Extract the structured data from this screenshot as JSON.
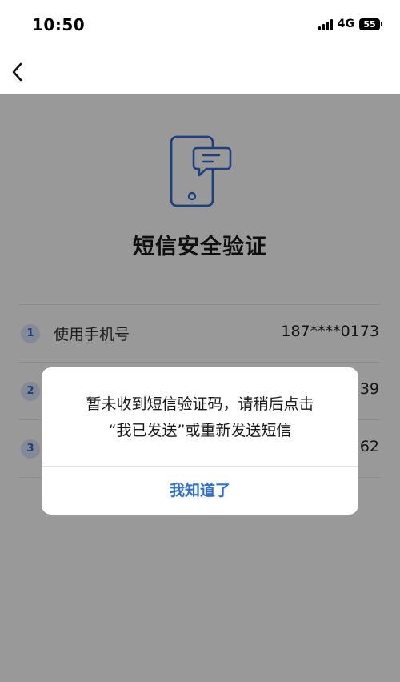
{
  "status_bar": {
    "time": "10:50",
    "network": "4G",
    "battery": "55"
  },
  "nav": {
    "back_icon": "chevron-left-icon"
  },
  "page": {
    "hero_icon": "phone-message-icon",
    "title": "短信安全验证",
    "steps": [
      {
        "num": "1",
        "label": "使用手机号",
        "value": "187****0173"
      },
      {
        "num": "2",
        "label": "",
        "value": "39"
      },
      {
        "num": "3",
        "label": "",
        "value": "62"
      }
    ]
  },
  "dialog": {
    "message_line1": "暂未收到短信验证码，请稍后点击",
    "message_line2": "“我已发送”或重新发送短信",
    "button_label": "我知道了"
  },
  "colors": {
    "accent": "#2f6fd0",
    "overlay": "rgba(0,0,0,0.40)"
  }
}
